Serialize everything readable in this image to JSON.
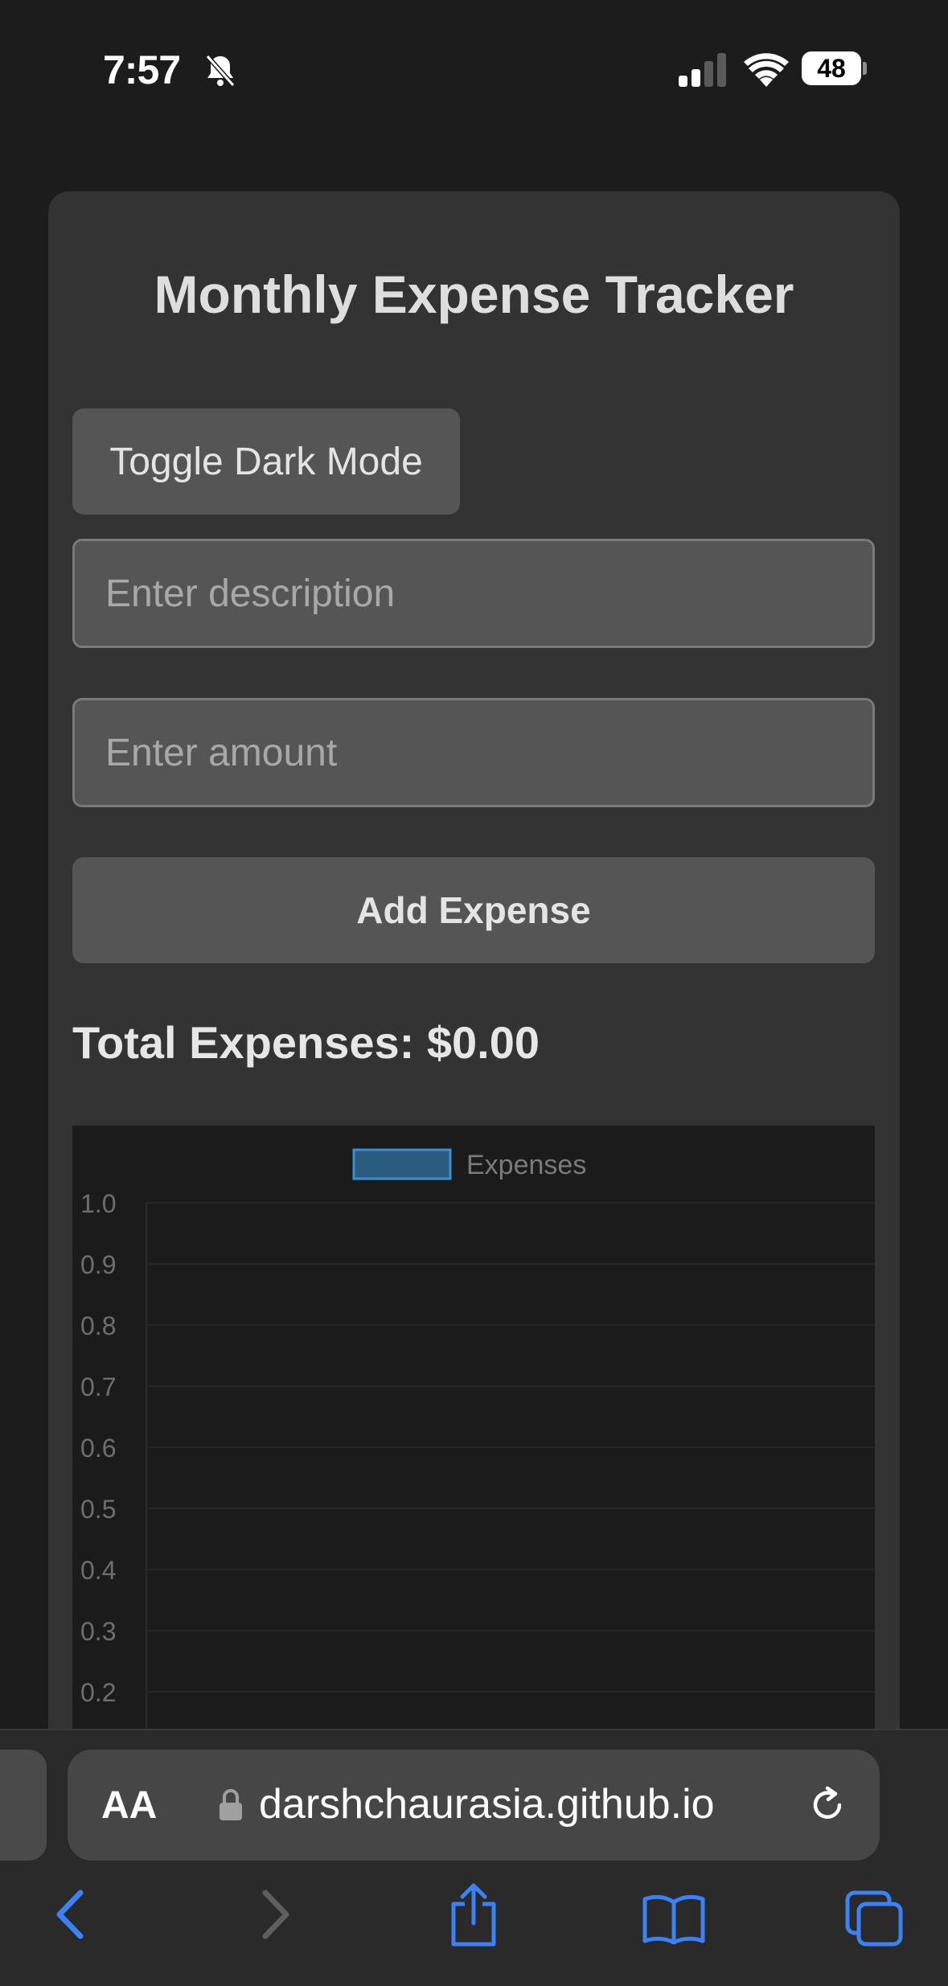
{
  "status_bar": {
    "time": "7:57",
    "battery": "48",
    "icons": [
      "bell-slash-icon",
      "cellular-signal-icon",
      "wifi-icon",
      "battery-icon"
    ]
  },
  "app": {
    "title": "Monthly Expense Tracker",
    "toggle_label": "Toggle Dark Mode",
    "description_placeholder": "Enter description",
    "amount_placeholder": "Enter amount",
    "add_label": "Add Expense",
    "total_text": "Total Expenses: $0.00"
  },
  "chart_data": {
    "type": "bar",
    "categories": [],
    "series": [
      {
        "name": "Expenses",
        "values": []
      }
    ],
    "y_ticks": [
      "1.0",
      "0.9",
      "0.8",
      "0.7",
      "0.6",
      "0.5",
      "0.4",
      "0.3",
      "0.2"
    ],
    "ylim": [
      0,
      1.0
    ],
    "legend": "top-center",
    "grid": true,
    "colors": {
      "series_fill": "#2b5c80",
      "series_border": "#3a8fd0"
    }
  },
  "browser": {
    "text_size_label": "AA",
    "url": "darshchaurasia.github.io",
    "icons": [
      "back-icon",
      "forward-icon",
      "share-icon",
      "bookmarks-icon",
      "tabs-icon",
      "reload-icon",
      "lock-icon"
    ],
    "accent_color": "#3b82f6"
  }
}
